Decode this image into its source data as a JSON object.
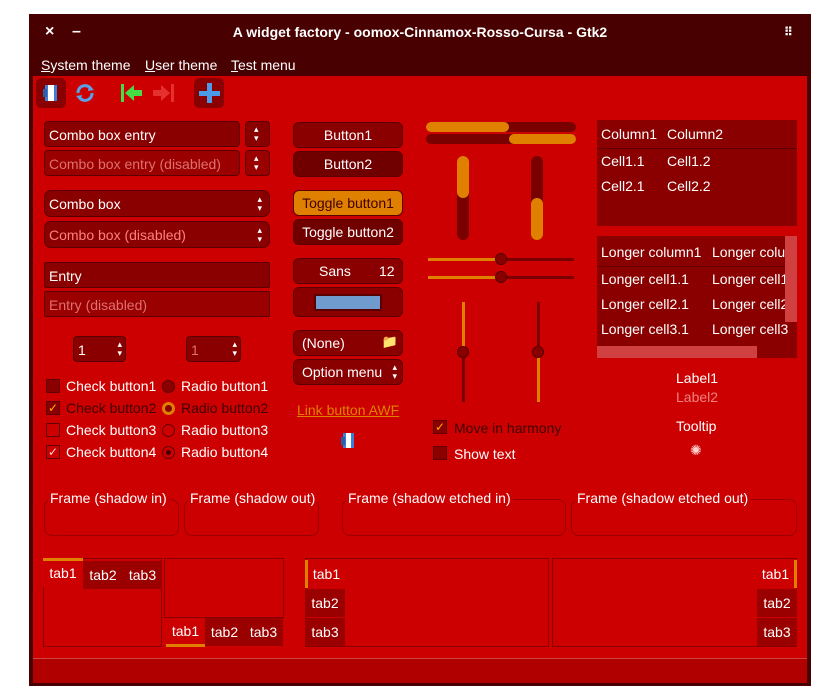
{
  "window": {
    "title": "A widget factory - oomox-Cinnamox-Rosso-Cursa - Gtk2"
  },
  "menu": {
    "system": "System theme",
    "user": "User theme",
    "test": "Test menu"
  },
  "col1": {
    "combo_entry": "Combo box entry",
    "combo_entry_disabled": "Combo box entry (disabled)",
    "combo": "Combo box",
    "combo_disabled": "Combo box (disabled)",
    "entry": "Entry",
    "entry_disabled": "Entry (disabled)",
    "spin1": "1",
    "spin2": "1",
    "check1": "Check button1",
    "check2": "Check button2",
    "check3": "Check button3",
    "check4": "Check button4",
    "radio1": "Radio button1",
    "radio2": "Radio button2",
    "radio3": "Radio button3",
    "radio4": "Radio button4"
  },
  "col2": {
    "button1": "Button1",
    "button2": "Button2",
    "toggle1": "Toggle button1",
    "toggle2": "Toggle button2",
    "font_name": "Sans",
    "font_size": "12",
    "color_value": "#6f9bcf",
    "file_chooser": "(None)",
    "option_menu": "Option menu",
    "link": "Link button AWF"
  },
  "col3": {
    "hprogress1": 0.55,
    "hprogress2": 0.45,
    "vprogress1": 0.5,
    "vprogress2": 0.5,
    "hscale1": 0.5,
    "hscale2": 0.5,
    "vscale1": 0.5,
    "vscale2": 0.5,
    "harmony": "Move in harmony",
    "show_text": "Show text"
  },
  "col4": {
    "tree1": {
      "headers": [
        "Column1",
        "Column2"
      ],
      "rows": [
        [
          "Cell1.1",
          "Cell1.2"
        ],
        [
          "Cell2.1",
          "Cell2.2"
        ]
      ]
    },
    "tree2": {
      "headers": [
        "Longer column1",
        "Longer colu"
      ],
      "rows": [
        [
          "Longer cell1.1",
          "Longer cell1"
        ],
        [
          "Longer cell2.1",
          "Longer cell2"
        ],
        [
          "Longer cell3.1",
          "Longer cell3"
        ]
      ]
    },
    "label1": "Label1",
    "label2": "Label2",
    "tooltip": "Tooltip"
  },
  "frames": {
    "in": "Frame (shadow in)",
    "out": "Frame (shadow out)",
    "etched_in": "Frame (shadow etched in)",
    "etched_out": "Frame (shadow etched out)"
  },
  "tabs": {
    "tab1": "tab1",
    "tab2": "tab2",
    "tab3": "tab3"
  },
  "colors": {
    "accent": "#e08000",
    "bg": "#cc0000",
    "dark": "#8a0000",
    "titlebar": "#480000"
  }
}
